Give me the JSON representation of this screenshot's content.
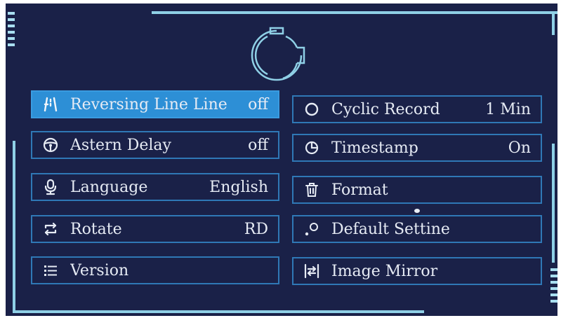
{
  "menu": {
    "left": [
      {
        "label": "Reversing Line Line",
        "value": "off",
        "icon": "reversing-line-icon",
        "selected": true
      },
      {
        "label": "Astern Delay",
        "value": "off",
        "icon": "steering-wheel-icon",
        "selected": false
      },
      {
        "label": "Language",
        "value": "English",
        "icon": "microphone-icon",
        "selected": false
      },
      {
        "label": "Rotate",
        "value": "RD",
        "icon": "rotate-icon",
        "selected": false
      },
      {
        "label": "Version",
        "value": "",
        "icon": "list-icon",
        "selected": false
      }
    ],
    "right": [
      {
        "label": "Cyclic Record",
        "value": "1  Min",
        "icon": "circle-icon",
        "selected": false
      },
      {
        "label": "Timestamp",
        "value": "On",
        "icon": "clock-icon",
        "selected": false
      },
      {
        "label": "Format",
        "value": "",
        "icon": "trash-icon",
        "selected": false
      },
      {
        "label": "Default  Settine",
        "value": "",
        "icon": "reset-icon",
        "selected": false
      },
      {
        "label": "Image Mirror",
        "value": "",
        "icon": "mirror-icon",
        "selected": false
      }
    ]
  },
  "colors": {
    "background": "#1a2148",
    "border": "#2f78b6",
    "selected": "#2d8fd6",
    "accent": "#8fd0e6"
  },
  "header_icon": "settings-gear-icon"
}
